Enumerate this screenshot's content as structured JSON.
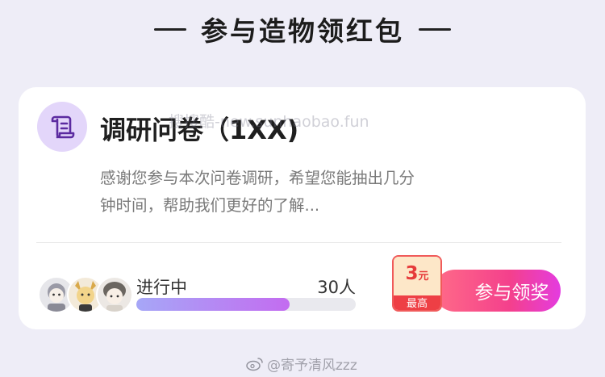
{
  "section": {
    "title": "参与造物领红包"
  },
  "card": {
    "title": "调研问卷（1XX)",
    "watermark": "搜搜酷-new.sunhaobao.fun",
    "description": "感谢您参与本次问卷调研，希望您能抽出几分钟时间，帮助我们更好的了解...",
    "status": "进行中",
    "participants": "30人",
    "progress_percent": 70,
    "reward": {
      "amount": "3",
      "unit": "元",
      "tag": "最高"
    },
    "action_label": "参与领奖"
  },
  "footer": {
    "credit": "@寄予清风zzz"
  },
  "colors": {
    "background": "#eeedf7",
    "icon_bg": "#e3d6fa",
    "icon_fg": "#5b2aa0",
    "progress_start": "#a6a7f7",
    "progress_end": "#c36cf0",
    "button_start": "#ff6b88",
    "button_end": "#e43ce0",
    "reward_red": "#ee3f45"
  },
  "icons": {
    "survey": "scroll-icon",
    "footer": "weibo-icon"
  }
}
